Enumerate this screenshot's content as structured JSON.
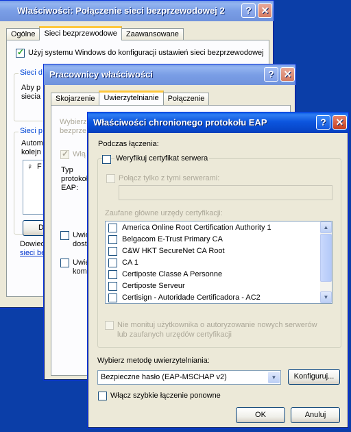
{
  "win1": {
    "title": "Właściwości: Połączenie sieci bezprzewodowej 2",
    "tabs": [
      "Ogólne",
      "Sieci bezprzewodowe",
      "Zaawansowane"
    ],
    "use_windows_label": "Użyj systemu Windows do konfiguracji ustawień sieci bezprzewodowej",
    "group1_title": "Sieci d",
    "group1_text": [
      "Aby p",
      "siecia"
    ],
    "group2_title": "Sieci p",
    "group2_text": [
      "Autom",
      "kolejn"
    ],
    "list_item": "F",
    "btn_partial": "Do",
    "bottom_text": "Dowied",
    "bottom_link": "sieci be"
  },
  "win2": {
    "title": "Pracownicy właściwości",
    "tabs": [
      "Skojarzenie",
      "Uwierzytelnianie",
      "Połączenie"
    ],
    "desc": [
      "Wybierz",
      "bezprze"
    ],
    "cb1_label": "Włą",
    "type_label": [
      "Typ",
      "protokoł",
      "EAP:"
    ],
    "cb2_label": [
      "Uwier",
      "dostęp"
    ],
    "cb3_label": [
      "Uwie",
      "komp"
    ]
  },
  "win3": {
    "title": "Właściwości chronionego protokołu EAP",
    "when_connecting": "Podczas łączenia:",
    "verify_cert": "Weryfikuj certyfikat serwera",
    "connect_only": "Połącz tylko z tymi serwerami:",
    "trusted_ca": "Zaufane główne urzędy certyfikacji:",
    "ca_list": [
      "America Online Root Certification Authority 1",
      "Belgacom E-Trust Primary CA",
      "C&W HKT SecureNet CA Root",
      "CA 1",
      "Certiposte Classe A Personne",
      "Certiposte Serveur",
      "Certisign - Autoridade Certificadora - AC2"
    ],
    "no_prompt": [
      "Nie monituj użytkownika o autoryzowanie nowych serwerów",
      "lub zaufanych urzędów certyfikacji"
    ],
    "select_method": "Wybierz metodę uwierzytelniania:",
    "method_value": "Bezpieczne hasło (EAP-MSCHAP v2)",
    "configure": "Konfiguruj...",
    "fast_reconnect": "Włącz szybkie łączenie ponowne",
    "ok": "OK",
    "cancel": "Anuluj",
    "help_glyph": "?",
    "close_glyph": "✕"
  }
}
